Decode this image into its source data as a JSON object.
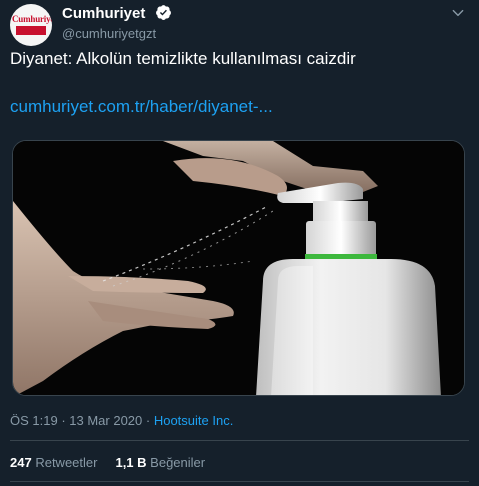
{
  "author": {
    "display_name": "Cumhuriyet",
    "handle": "@cumhuriyetgzt",
    "verified": true,
    "avatar_logo_text": "Cumhuriyet"
  },
  "tweet": {
    "text": "Diyanet: Alkolün temizlikte kullanılması caizdir",
    "link": "cumhuriyet.com.tr/haber/diyanet-..."
  },
  "meta": {
    "time": "ÖS 1:19",
    "separator": " · ",
    "date": "13 Mar 2020",
    "source": "Hootsuite Inc."
  },
  "stats": {
    "retweets_count": "247",
    "retweets_label": "Retweetler",
    "likes_count": "1,1 B",
    "likes_label": "Beğeniler"
  },
  "colors": {
    "background": "#15202b",
    "link": "#1da1f2",
    "secondary_text": "#8899a6",
    "divider": "#38444d",
    "verified": "#ffffff"
  }
}
